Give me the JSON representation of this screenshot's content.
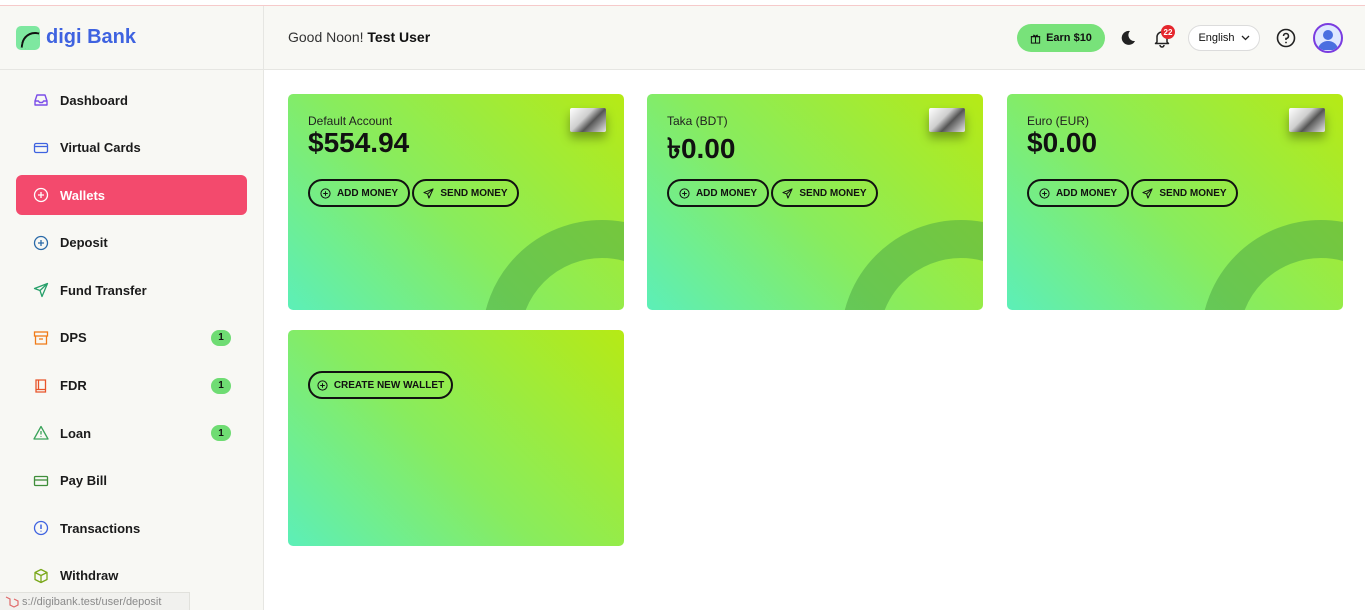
{
  "brand": {
    "name": "digi Bank"
  },
  "header": {
    "greeting_prefix": "Good Noon!",
    "user_name": "Test User",
    "earn_label": "Earn $10",
    "notifications_count": "22",
    "language": "English"
  },
  "sidebar": {
    "items": [
      {
        "label": "Dashboard",
        "icon": "inbox-icon"
      },
      {
        "label": "Virtual Cards",
        "icon": "card-icon"
      },
      {
        "label": "Wallets",
        "icon": "plus-circle-icon",
        "active": true
      },
      {
        "label": "Deposit",
        "icon": "plus-circle-icon"
      },
      {
        "label": "Fund Transfer",
        "icon": "send-icon"
      },
      {
        "label": "DPS",
        "icon": "archive-icon",
        "badge": "1"
      },
      {
        "label": "FDR",
        "icon": "book-icon",
        "badge": "1"
      },
      {
        "label": "Loan",
        "icon": "warning-icon",
        "badge": "1"
      },
      {
        "label": "Pay Bill",
        "icon": "bill-icon"
      },
      {
        "label": "Transactions",
        "icon": "info-icon"
      },
      {
        "label": "Withdraw",
        "icon": "box-icon"
      }
    ]
  },
  "status_url": "s://digibank.test/user/deposit",
  "wallets": [
    {
      "label": "Default Account",
      "amount": "$554.94",
      "add": "ADD MONEY",
      "send": "SEND MONEY"
    },
    {
      "label": "Taka (BDT)",
      "amount": "৳0.00",
      "add": "ADD MONEY",
      "send": "SEND MONEY"
    },
    {
      "label": "Euro (EUR)",
      "amount": "$0.00",
      "add": "ADD MONEY",
      "send": "SEND MONEY"
    }
  ],
  "create_wallet_label": "CREATE NEW WALLET",
  "colors": {
    "accent": "#f34a6d",
    "brand": "#3f63e0",
    "earn": "#78e27a"
  }
}
